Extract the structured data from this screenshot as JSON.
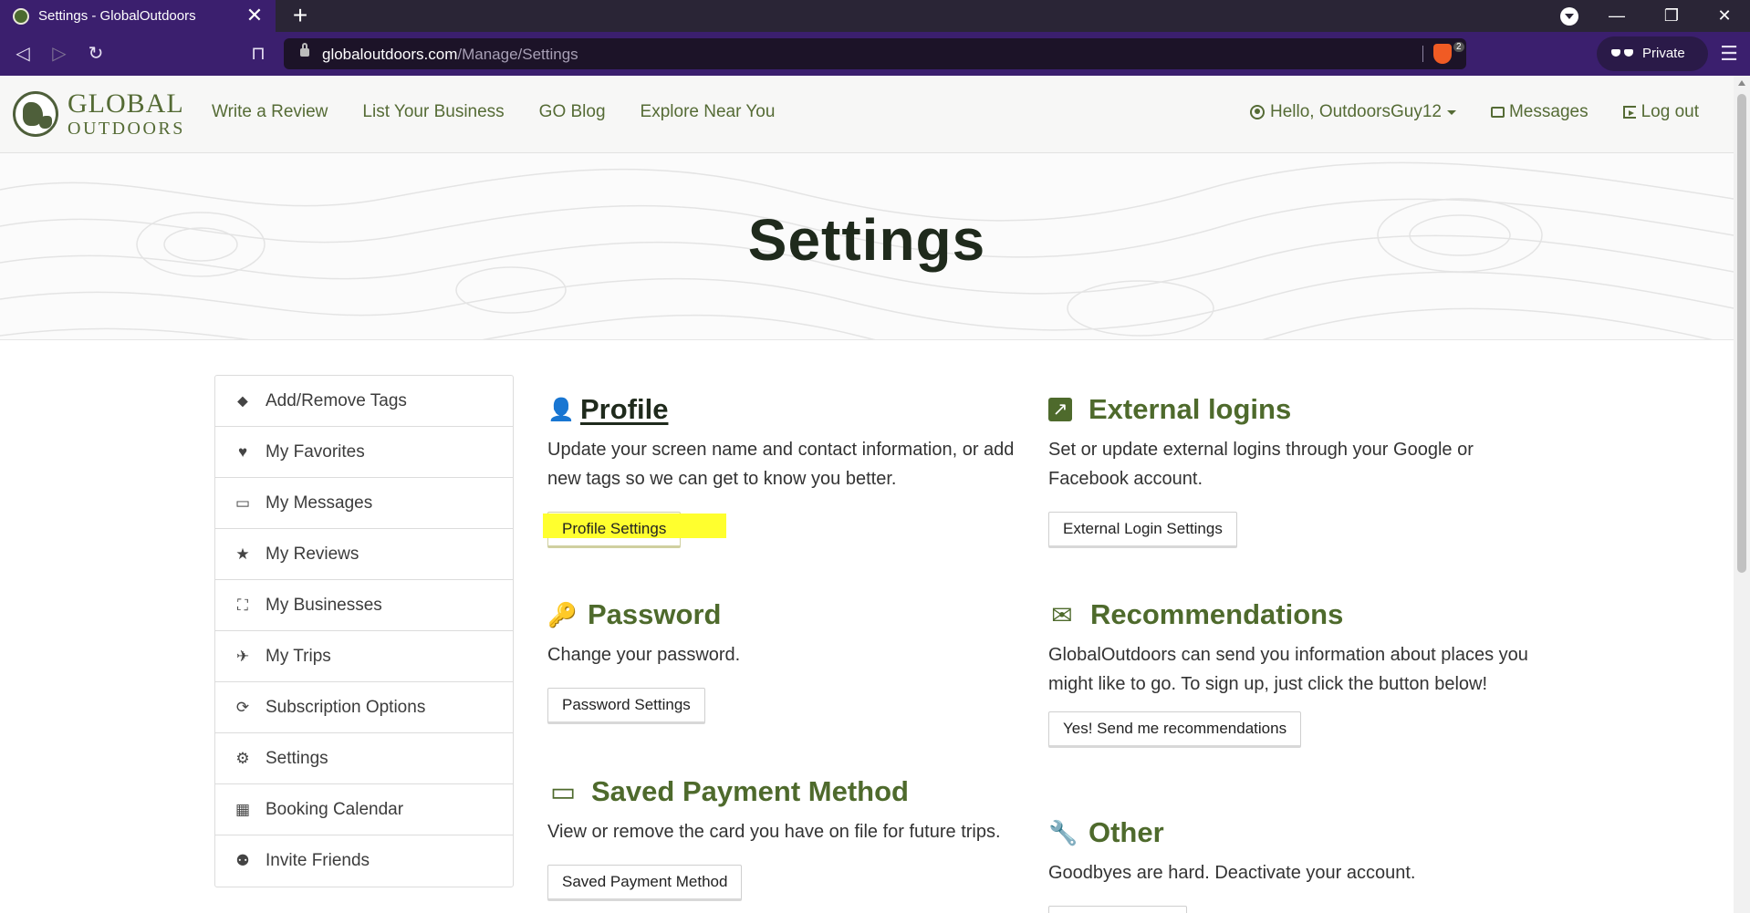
{
  "browser": {
    "tab_title": "Settings - GlobalOutdoors",
    "tab_close": "✕",
    "new_tab": "+",
    "url_host": "globaloutdoors.com",
    "url_path": "/Manage/Settings",
    "brave_count": "2",
    "private_label": "Private",
    "nav_back": "◁",
    "nav_forward": "▷",
    "nav_reload": "↻",
    "bookmark": "⊓",
    "menu": "☰",
    "win_minimize": "—",
    "win_restore": "❐",
    "win_close": "✕"
  },
  "site": {
    "logo_line1": "GLOBAL",
    "logo_line2": "OUTDOORS",
    "nav": [
      "Write a Review",
      "List Your Business",
      "GO Blog",
      "Explore Near You"
    ],
    "user_greeting": "Hello, OutdoorsGuy12",
    "messages": "Messages",
    "logout": "Log out"
  },
  "hero": {
    "title": "Settings"
  },
  "sidebar": {
    "items": [
      {
        "label": "Add/Remove Tags",
        "icon": "tags-icon",
        "glyph": "⬥"
      },
      {
        "label": "My Favorites",
        "icon": "heart-icon",
        "glyph": "♥"
      },
      {
        "label": "My Messages",
        "icon": "inbox-icon",
        "glyph": "▭"
      },
      {
        "label": "My Reviews",
        "icon": "star-icon",
        "glyph": "★"
      },
      {
        "label": "My Businesses",
        "icon": "binoculars-icon",
        "glyph": "⛶"
      },
      {
        "label": "My Trips",
        "icon": "plane-icon",
        "glyph": "✈"
      },
      {
        "label": "Subscription Options",
        "icon": "refresh-icon",
        "glyph": "⟳"
      },
      {
        "label": "Settings",
        "icon": "gear-icon",
        "glyph": "⚙"
      },
      {
        "label": "Booking Calendar",
        "icon": "calendar-icon",
        "glyph": "▦"
      },
      {
        "label": "Invite Friends",
        "icon": "users-icon",
        "glyph": "⚉"
      }
    ]
  },
  "sections": {
    "profile": {
      "title": "Profile",
      "text": "Update your screen name and contact information, or add new tags so we can get to know you better.",
      "button": "Profile Settings",
      "glyph": "👤"
    },
    "password": {
      "title": "Password",
      "text": "Change your password.",
      "button": "Password Settings",
      "glyph": "🔑"
    },
    "payment": {
      "title": "Saved Payment Method",
      "text": "View or remove the card you have on file for future trips.",
      "button": "Saved Payment Method",
      "glyph": "▭"
    },
    "external": {
      "title": "External logins",
      "text": "Set or update external logins through your Google or Facebook account.",
      "button": "External Login Settings",
      "glyph": "↗"
    },
    "recommendations": {
      "title": "Recommendations",
      "text": "GlobalOutdoors can send you information about places you might like to go. To sign up, just click the button below!",
      "button": "Yes! Send me recommendations",
      "glyph": "✉"
    },
    "other": {
      "title": "Other",
      "text": "Goodbyes are hard. Deactivate your account.",
      "glyph": "🔧"
    }
  },
  "colors": {
    "brand_green": "#556b35",
    "heading_green": "#4e6a2c",
    "browser_purple": "#3b1f6e",
    "highlight_yellow": "#ffff2e"
  }
}
